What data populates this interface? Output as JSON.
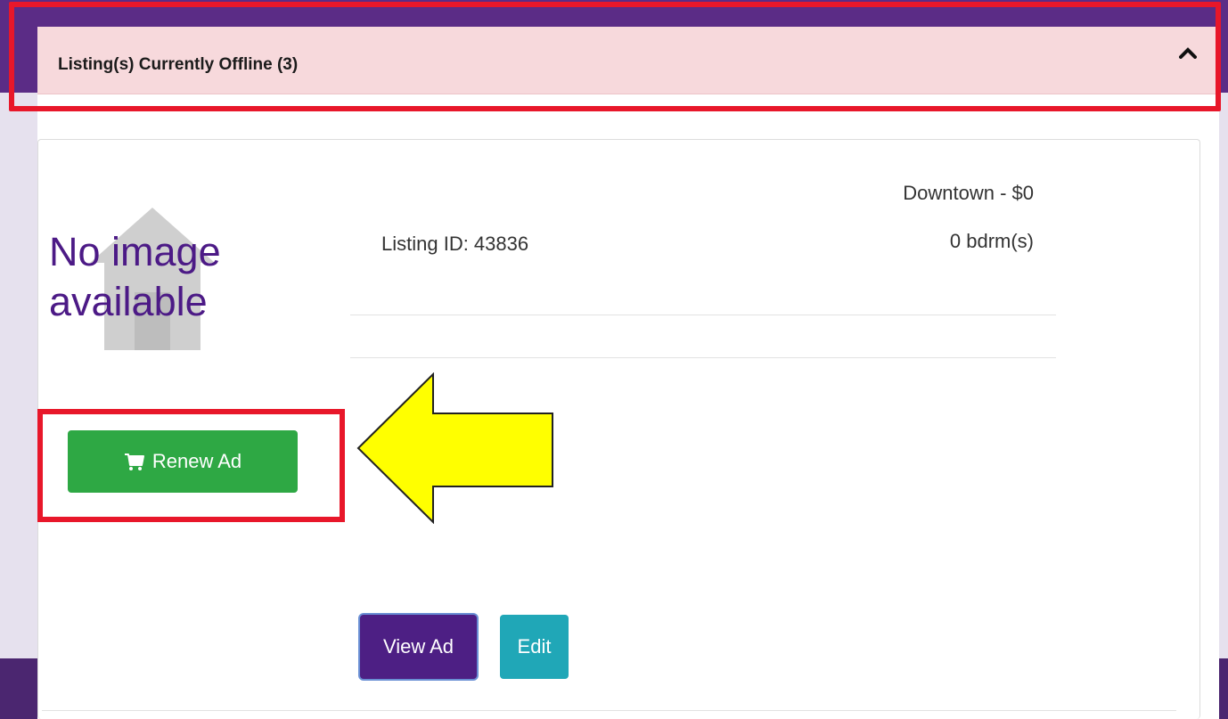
{
  "panel": {
    "title": "Listing(s) Currently Offline (3)"
  },
  "listing": {
    "no_image_text": "No image\navailable",
    "listing_id": "Listing ID: 43836",
    "location_price": "Downtown - $0",
    "bedrooms": "0 bdrm(s)"
  },
  "actions": {
    "renew_label": "Renew Ad",
    "view_label": "View Ad",
    "edit_label": "Edit"
  },
  "colors": {
    "header_bg": "#f7d9dc",
    "renew_green": "#2ea844",
    "view_purple": "#4d1f84",
    "edit_teal": "#20a7b7",
    "highlight_red": "#e8172a",
    "arrow_yellow": "#ffff00"
  },
  "icons": {
    "collapse": "chevron-up-icon",
    "cart": "cart-icon",
    "placeholder": "house-icon"
  }
}
